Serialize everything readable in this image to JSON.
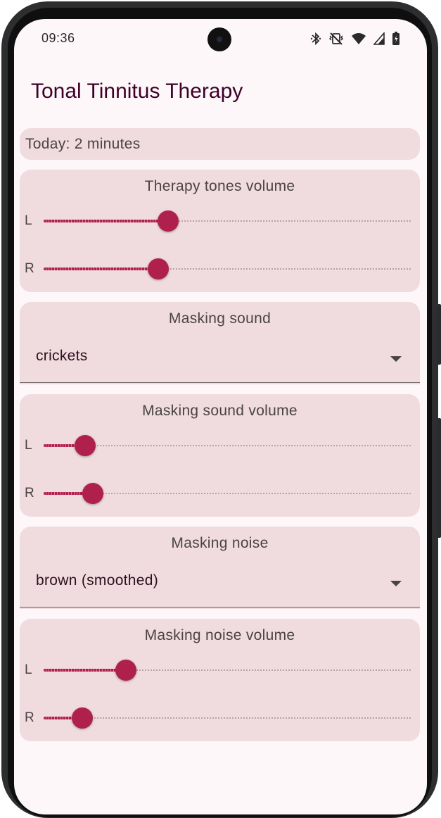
{
  "status_bar": {
    "time": "09:36",
    "icons": [
      "bluetooth-icon",
      "vibrate-off-icon",
      "wifi-icon",
      "cell-signal-icon",
      "battery-icon"
    ]
  },
  "app": {
    "title": "Tonal Tinnitus Therapy"
  },
  "today": {
    "text": "Today: 2 minutes"
  },
  "therapy_tones": {
    "title": "Therapy tones volume",
    "left": {
      "label": "L",
      "value": 0.34
    },
    "right": {
      "label": "R",
      "value": 0.313
    }
  },
  "masking_sound": {
    "title": "Masking sound",
    "selected": "crickets"
  },
  "masking_sound_volume": {
    "title": "Masking sound volume",
    "left": {
      "label": "L",
      "value": 0.113
    },
    "right": {
      "label": "R",
      "value": 0.134
    }
  },
  "masking_noise": {
    "title": "Masking noise",
    "selected": "brown (smoothed)"
  },
  "masking_noise_volume": {
    "title": "Masking noise volume",
    "left": {
      "label": "L",
      "value": 0.224
    },
    "right": {
      "label": "R",
      "value": 0.105
    }
  },
  "colors": {
    "accent": "#b0204f",
    "card_bg": "#f0dcde",
    "screen_bg": "#fdf7fa",
    "title": "#3e0028"
  }
}
